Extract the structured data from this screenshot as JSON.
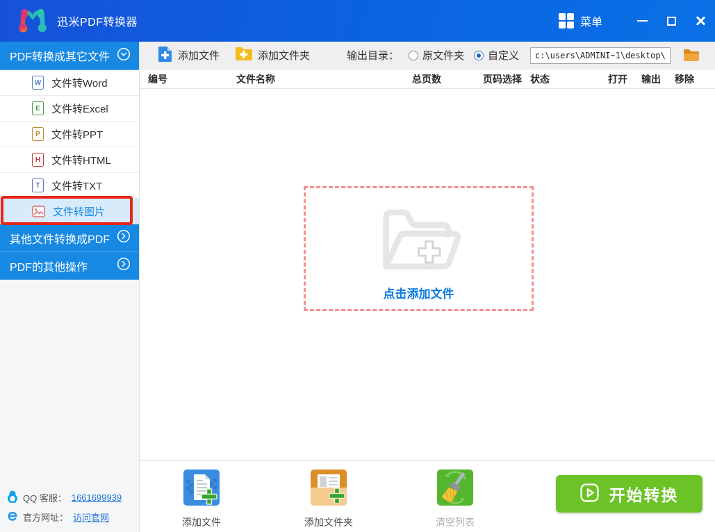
{
  "colors": {
    "titlebar_gradient_start": "#1652d8",
    "titlebar_gradient_end": "#0a70e6",
    "section_header_blue": "#1789e2",
    "selected_item_bg": "#d8ebfa",
    "selected_item_text": "#1789e2",
    "annotation_red": "#e52618",
    "dropzone_border_pink": "#f49090",
    "dropzone_text_blue": "#0a7ae0",
    "start_button_green": "#6cc327",
    "link_blue": "#1a73d9",
    "toolbar_bg": "#efeff0"
  },
  "icons": {
    "app-logo-icon": "m-droplets",
    "menu-grid-icon": "2x2-grid",
    "minimize-icon": "bar",
    "maximize-icon": "square-outline",
    "close-icon": "x-cross",
    "add-file-icon": "blue-doc-plus",
    "add-folder-icon": "yellow-folder-plus",
    "browse-folder-icon": "orange-folder",
    "chevron-down-circle-icon": "circled-chevron-down",
    "chevron-right-circle-icon": "circled-chevron-right",
    "image-file-icon": "picture-frame",
    "dropzone-folder-icon": "open-folder-plus",
    "add-file-big-icon": "doc-green-plus-tile",
    "add-folder-big-icon": "folder-green-plus-tile",
    "clear-list-big-icon": "broom-tile",
    "play-icon": "play-in-rounded-square",
    "qq-icon": "penguin",
    "ie-icon": "e-browser"
  },
  "titlebar": {
    "app_title": "迅米PDF转换器",
    "menu_label": "菜单"
  },
  "toolbar": {
    "add_file_label": "添加文件",
    "add_folder_label": "添加文件夹",
    "output_dir_label": "输出目录：",
    "radio_original_label": "原文件夹",
    "radio_custom_label": "自定义",
    "radio_selected": "自定义",
    "output_path": "c:\\users\\ADMINI~1\\desktop\\"
  },
  "sidebar": {
    "group1_header": "PDF转换成其它文件",
    "items": [
      {
        "label": "文件转Word",
        "letter": "W"
      },
      {
        "label": "文件转Excel",
        "letter": "E"
      },
      {
        "label": "文件转PPT",
        "letter": "P"
      },
      {
        "label": "文件转HTML",
        "letter": "H"
      },
      {
        "label": "文件转TXT",
        "letter": "T"
      },
      {
        "label": "文件转图片",
        "letter": "",
        "selected": true
      }
    ],
    "group2_header": "其他文件转换成PDF",
    "group3_header": "PDF的其他操作",
    "footer": {
      "qq_label": "QQ 客服：",
      "qq_link": "1661699939",
      "site_label": "官方网址：",
      "site_link": "访问官网"
    }
  },
  "table": {
    "columns": [
      "编号",
      "文件名称",
      "总页数",
      "页码选择",
      "状态",
      "打开",
      "输出",
      "移除"
    ]
  },
  "dropzone": {
    "label": "点击添加文件"
  },
  "bottombar": {
    "actions": [
      {
        "label": "添加文件"
      },
      {
        "label": "添加文件夹"
      },
      {
        "label": "清空列表"
      }
    ],
    "start_button_label": "开始转换"
  }
}
